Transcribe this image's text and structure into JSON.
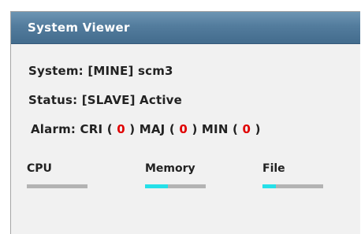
{
  "panel": {
    "title": "System Viewer"
  },
  "system": {
    "label": "System:",
    "value": "[MINE] scm3"
  },
  "status": {
    "label": "Status:",
    "value": "[SLAVE] Active"
  },
  "alarm": {
    "label": "Alarm:",
    "items": [
      {
        "name": "CRI",
        "count": "0"
      },
      {
        "name": "MAJ",
        "count": "0"
      },
      {
        "name": "MIN",
        "count": "0"
      }
    ]
  },
  "meters": [
    {
      "label": "CPU",
      "usage": 0.0
    },
    {
      "label": "Memory",
      "usage": 0.38
    },
    {
      "label": "File",
      "usage": 0.22
    }
  ],
  "colors": {
    "title_bar": "#537c9d",
    "alarm_count": "#e00000",
    "meter_fill": "#25e0e8",
    "meter_track": "#b3b3b3"
  }
}
